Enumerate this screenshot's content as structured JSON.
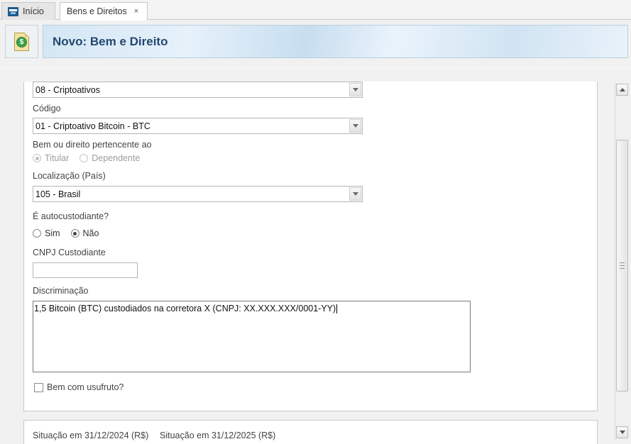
{
  "tabs": {
    "home_label": "Início",
    "active_label": "Bens e Direitos",
    "close_glyph": "×"
  },
  "header": {
    "title": "Novo: Bem e Direito",
    "icon": "document-money-icon"
  },
  "form": {
    "grupo_select": {
      "value": "08 - Criptoativos"
    },
    "codigo": {
      "label": "Código",
      "value": "01 - Criptoativo Bitcoin - BTC"
    },
    "pertencente": {
      "label": "Bem ou direito pertencente ao",
      "options": [
        "Titular",
        "Dependente"
      ],
      "selected": "Titular"
    },
    "localizacao": {
      "label": "Localização (País)",
      "value": "105 - Brasil"
    },
    "autocustodiante": {
      "label": "É autocustodiante?",
      "options": [
        "Sim",
        "Não"
      ],
      "selected": "Não"
    },
    "cnpj_custodiante": {
      "label": "CNPJ Custodiante",
      "value": ""
    },
    "discriminacao": {
      "label": "Discriminação",
      "value": "1,5 Bitcoin (BTC) custodiados na corretora X (CNPJ: XX.XXX.XXX/0001-YY)"
    },
    "usufruto": {
      "label": "Bem com usufruto?",
      "checked": false
    }
  },
  "situacao": {
    "label_2024": "Situação em 31/12/2024 (R$)",
    "label_2025": "Situação em 31/12/2025 (R$)"
  }
}
